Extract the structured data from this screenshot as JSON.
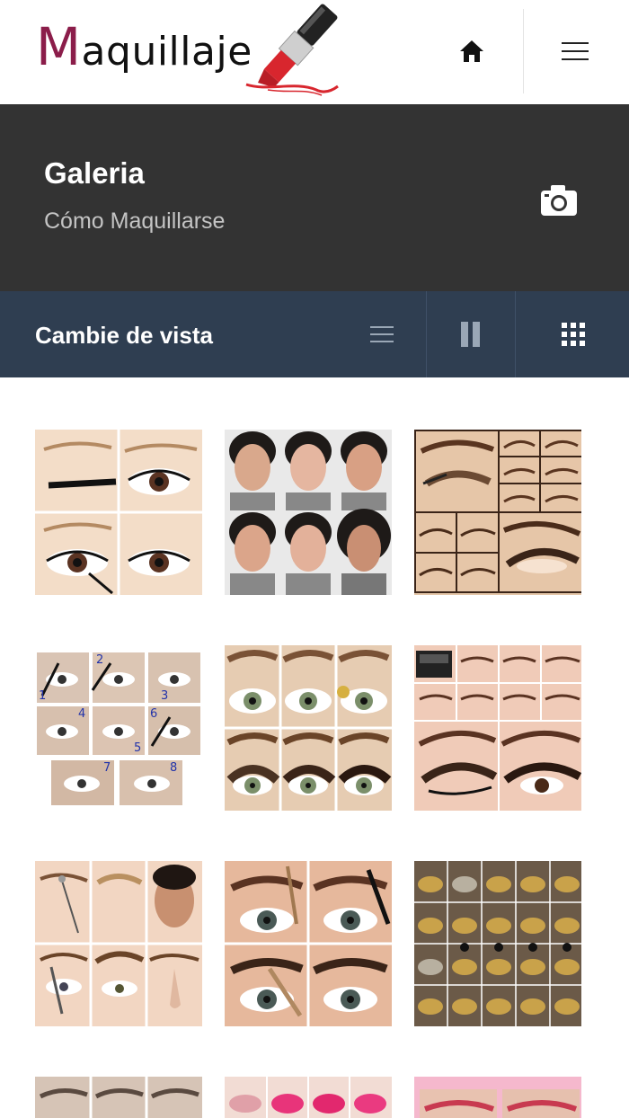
{
  "header": {
    "logo": {
      "text": "Maquillaje"
    },
    "home_icon": "home-icon",
    "menu_icon": "hamburger-menu-icon"
  },
  "hero": {
    "title": "Galeria",
    "subtitle": "Cómo Maquillarse",
    "icon": "camera-icon"
  },
  "view_bar": {
    "label": "Cambie de vista",
    "options": [
      {
        "name": "list-view",
        "icon": "list-icon"
      },
      {
        "name": "two-column-view",
        "icon": "two-columns-icon"
      },
      {
        "name": "grid-view",
        "icon": "grid-icon"
      }
    ]
  },
  "gallery": {
    "items": [
      {
        "name": "eyeliner-steps",
        "icon": "photo-eye-makeup"
      },
      {
        "name": "contour-faces",
        "icon": "photo-face-contour"
      },
      {
        "name": "smoky-eye-steps",
        "icon": "photo-eye-makeup"
      },
      {
        "name": "numbered-eyeshadow-steps",
        "icon": "photo-eye-makeup"
      },
      {
        "name": "green-eye-smoky",
        "icon": "photo-eye-makeup"
      },
      {
        "name": "palette-eye-steps",
        "icon": "photo-eye-makeup"
      },
      {
        "name": "brow-shaping-steps",
        "icon": "photo-face"
      },
      {
        "name": "brow-brush-steps",
        "icon": "photo-eye-makeup"
      },
      {
        "name": "glitter-eye-steps",
        "icon": "photo-eye-makeup"
      },
      {
        "name": "brow-row-partial",
        "icon": "photo-eye-makeup"
      },
      {
        "name": "pink-lips-partial",
        "icon": "photo-lips"
      },
      {
        "name": "lip-liner-partial",
        "icon": "photo-lips"
      }
    ]
  },
  "colors": {
    "hero_bg": "#333333",
    "viewbar_bg": "#2f3e51",
    "logo_accent": "#8b1d4a",
    "lipstick_red": "#d8262e"
  }
}
